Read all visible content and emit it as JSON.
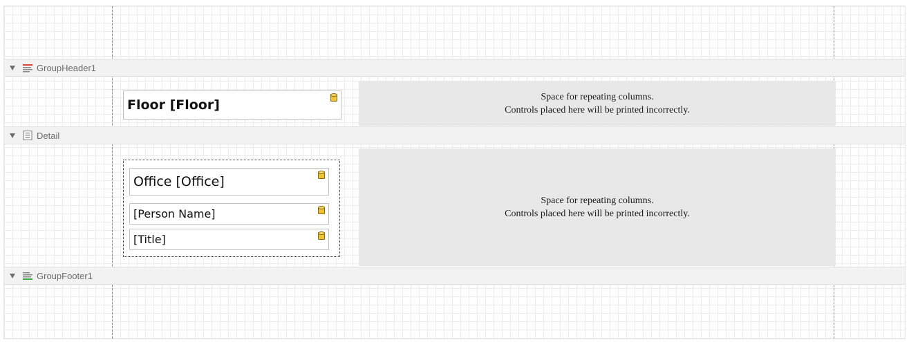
{
  "bands": [
    {
      "name": "GroupHeader1",
      "color": "#d9443b"
    },
    {
      "name": "Detail",
      "color": "#6b6b6b"
    },
    {
      "name": "GroupFooter1",
      "color": "#3aa84b"
    }
  ],
  "repeating_space": {
    "line1": "Space for repeating columns.",
    "line2": "Controls placed here will be printed incorrectly."
  },
  "fields": {
    "floor": "Floor [Floor]",
    "office": "Office [Office]",
    "person_name": "[Person Name]",
    "title": "[Title]"
  },
  "icons": {
    "collapse": "triangle-down-icon",
    "data_bound": "database-icon"
  }
}
